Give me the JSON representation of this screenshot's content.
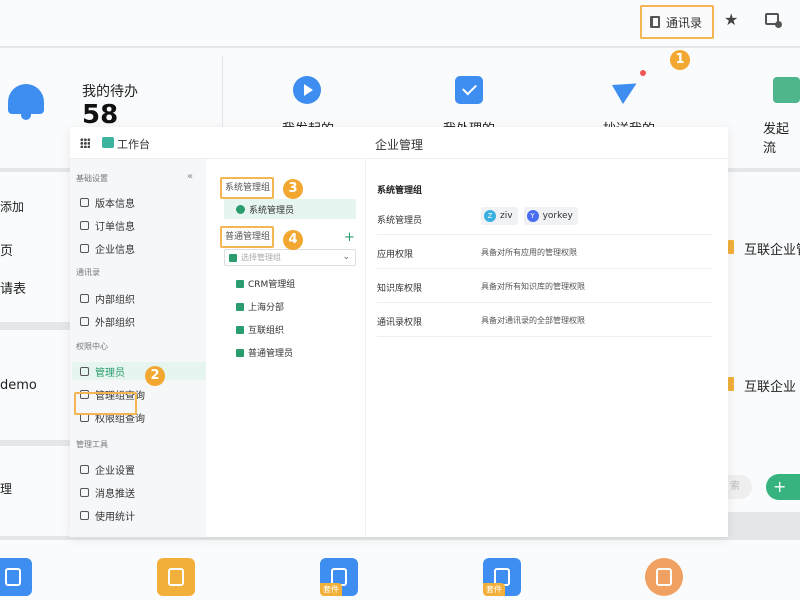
{
  "topbar": {
    "contacts_label": "通讯录"
  },
  "badges": [
    "1",
    "2",
    "3",
    "4"
  ],
  "dashboard": {
    "todo_label": "我的待办",
    "todo_count": "58",
    "stats": [
      "我发起的",
      "我处理的",
      "抄送我的",
      "发起流"
    ],
    "left_items": [
      "添加",
      "页",
      "请表",
      "demo",
      "理"
    ],
    "right_items": [
      "互联企业管",
      "互联企业"
    ],
    "search_text": "索",
    "add_label": "+",
    "suite_tag": "套件"
  },
  "modal": {
    "workbench_label": "工作台",
    "title": "企业管理",
    "sidebar": {
      "sections": [
        {
          "title": "基础设置",
          "items": [
            "版本信息",
            "订单信息",
            "企业信息"
          ]
        },
        {
          "title": "通讯录",
          "items": [
            "内部组织",
            "外部组织"
          ]
        },
        {
          "title": "权限中心",
          "items": [
            "管理员",
            "管理组查询",
            "权限组查询"
          ]
        },
        {
          "title": "管理工具",
          "items": [
            "企业设置",
            "消息推送",
            "使用统计"
          ]
        }
      ],
      "collapse": "«"
    },
    "groups": {
      "system_group_label": "系统管理组",
      "system_admin": "系统管理员",
      "normal_group_label": "普通管理组",
      "add": "+",
      "select_placeholder": "选择管理组",
      "items": [
        "CRM管理组",
        "上海分部",
        "互联组织",
        "普通管理员"
      ]
    },
    "detail": {
      "title": "系统管理组",
      "rows": [
        {
          "label": "系统管理员",
          "value": ""
        },
        {
          "label": "应用权限",
          "value": "具备对所有应用的管理权限"
        },
        {
          "label": "知识库权限",
          "value": "具备对所有知识库的管理权限"
        },
        {
          "label": "通讯录权限",
          "value": "具备对通讯录的全部管理权限"
        }
      ],
      "admins": [
        {
          "initial": "Z",
          "name": "ziv"
        },
        {
          "initial": "Y",
          "name": "yorkey"
        }
      ]
    }
  },
  "colors": {
    "highlight": "#f4b553",
    "accent_green": "#2a9d6e",
    "accent_blue": "#3d8ef0"
  }
}
